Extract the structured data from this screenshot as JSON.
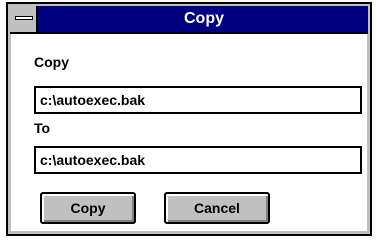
{
  "window": {
    "title": "Copy"
  },
  "form": {
    "from_label": "Copy",
    "from_value": "c:\\autoexec.bak",
    "to_label": "To",
    "to_value": "c:\\autoexec.bak"
  },
  "buttons": {
    "copy_label": "Copy",
    "cancel_label": "Cancel"
  },
  "colors": {
    "titlebar": "#000080",
    "button_face": "#c0c0c0"
  }
}
